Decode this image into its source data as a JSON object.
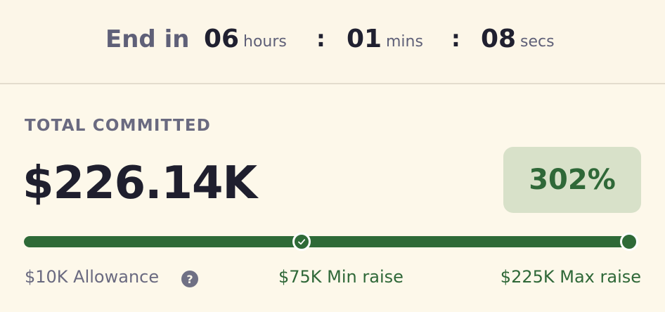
{
  "timer": {
    "label": "End in",
    "hours": "06",
    "hours_unit": "hours",
    "mins": "01",
    "mins_unit": "mins",
    "secs": "08",
    "secs_unit": "secs",
    "separator": ":"
  },
  "commit": {
    "label": "TOTAL COMMITTED",
    "amount": "$226.14K",
    "percent": "302%",
    "progress_fraction": 1.0,
    "milestones": {
      "allowance": "$10K Allowance",
      "min": "$75K Min raise",
      "max": "$225K Max raise"
    },
    "help_glyph": "?"
  },
  "colors": {
    "accent": "#2e6a37",
    "badge_bg": "#d8e1c9",
    "background": "#fdf8ea"
  },
  "icons": {
    "min_marker": "check-icon",
    "help": "question-circle-icon"
  }
}
